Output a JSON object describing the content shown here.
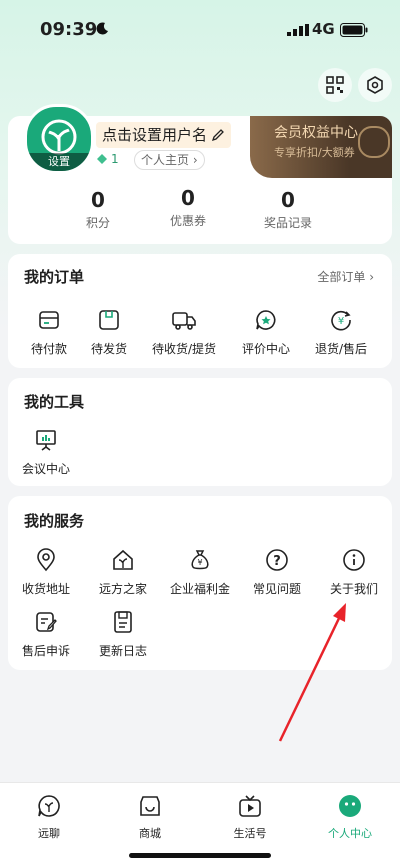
{
  "status": {
    "time": "09:39",
    "network": "4G"
  },
  "profile": {
    "avatar_tag": "设置",
    "username_prompt": "点击设置用户名",
    "level": "1",
    "homepage_link": "个人主页"
  },
  "vip": {
    "title": "会员权益中心",
    "subtitle": "专享折扣/大额券"
  },
  "stats": [
    {
      "value": "0",
      "label": "积分"
    },
    {
      "value": "0",
      "label": "优惠券"
    },
    {
      "value": "0",
      "label": "奖品记录"
    }
  ],
  "orders": {
    "title": "我的订单",
    "all_link": "全部订单",
    "items": [
      {
        "label": "待付款",
        "icon": "wallet-icon"
      },
      {
        "label": "待发货",
        "icon": "package-icon"
      },
      {
        "label": "待收货/提货",
        "icon": "truck-icon"
      },
      {
        "label": "评价中心",
        "icon": "review-icon"
      },
      {
        "label": "退货/售后",
        "icon": "refund-icon"
      }
    ]
  },
  "tools": {
    "title": "我的工具",
    "items": [
      {
        "label": "会议中心",
        "icon": "presentation-icon"
      }
    ]
  },
  "services": {
    "title": "我的服务",
    "items": [
      {
        "label": "收货地址",
        "icon": "location-icon"
      },
      {
        "label": "远方之家",
        "icon": "house-icon"
      },
      {
        "label": "企业福利金",
        "icon": "money-bag-icon"
      },
      {
        "label": "常见问题",
        "icon": "question-icon"
      },
      {
        "label": "关于我们",
        "icon": "info-icon"
      },
      {
        "label": "售后申诉",
        "icon": "edit-note-icon"
      },
      {
        "label": "更新日志",
        "icon": "log-icon"
      }
    ]
  },
  "tabs": [
    {
      "label": "远聊",
      "icon": "chat-icon"
    },
    {
      "label": "商城",
      "icon": "shop-icon"
    },
    {
      "label": "生活号",
      "icon": "video-icon"
    },
    {
      "label": "个人中心",
      "icon": "profile-icon",
      "active": true
    }
  ],
  "colors": {
    "accent": "#1aa97a",
    "annotation_arrow": "#e8232a"
  }
}
